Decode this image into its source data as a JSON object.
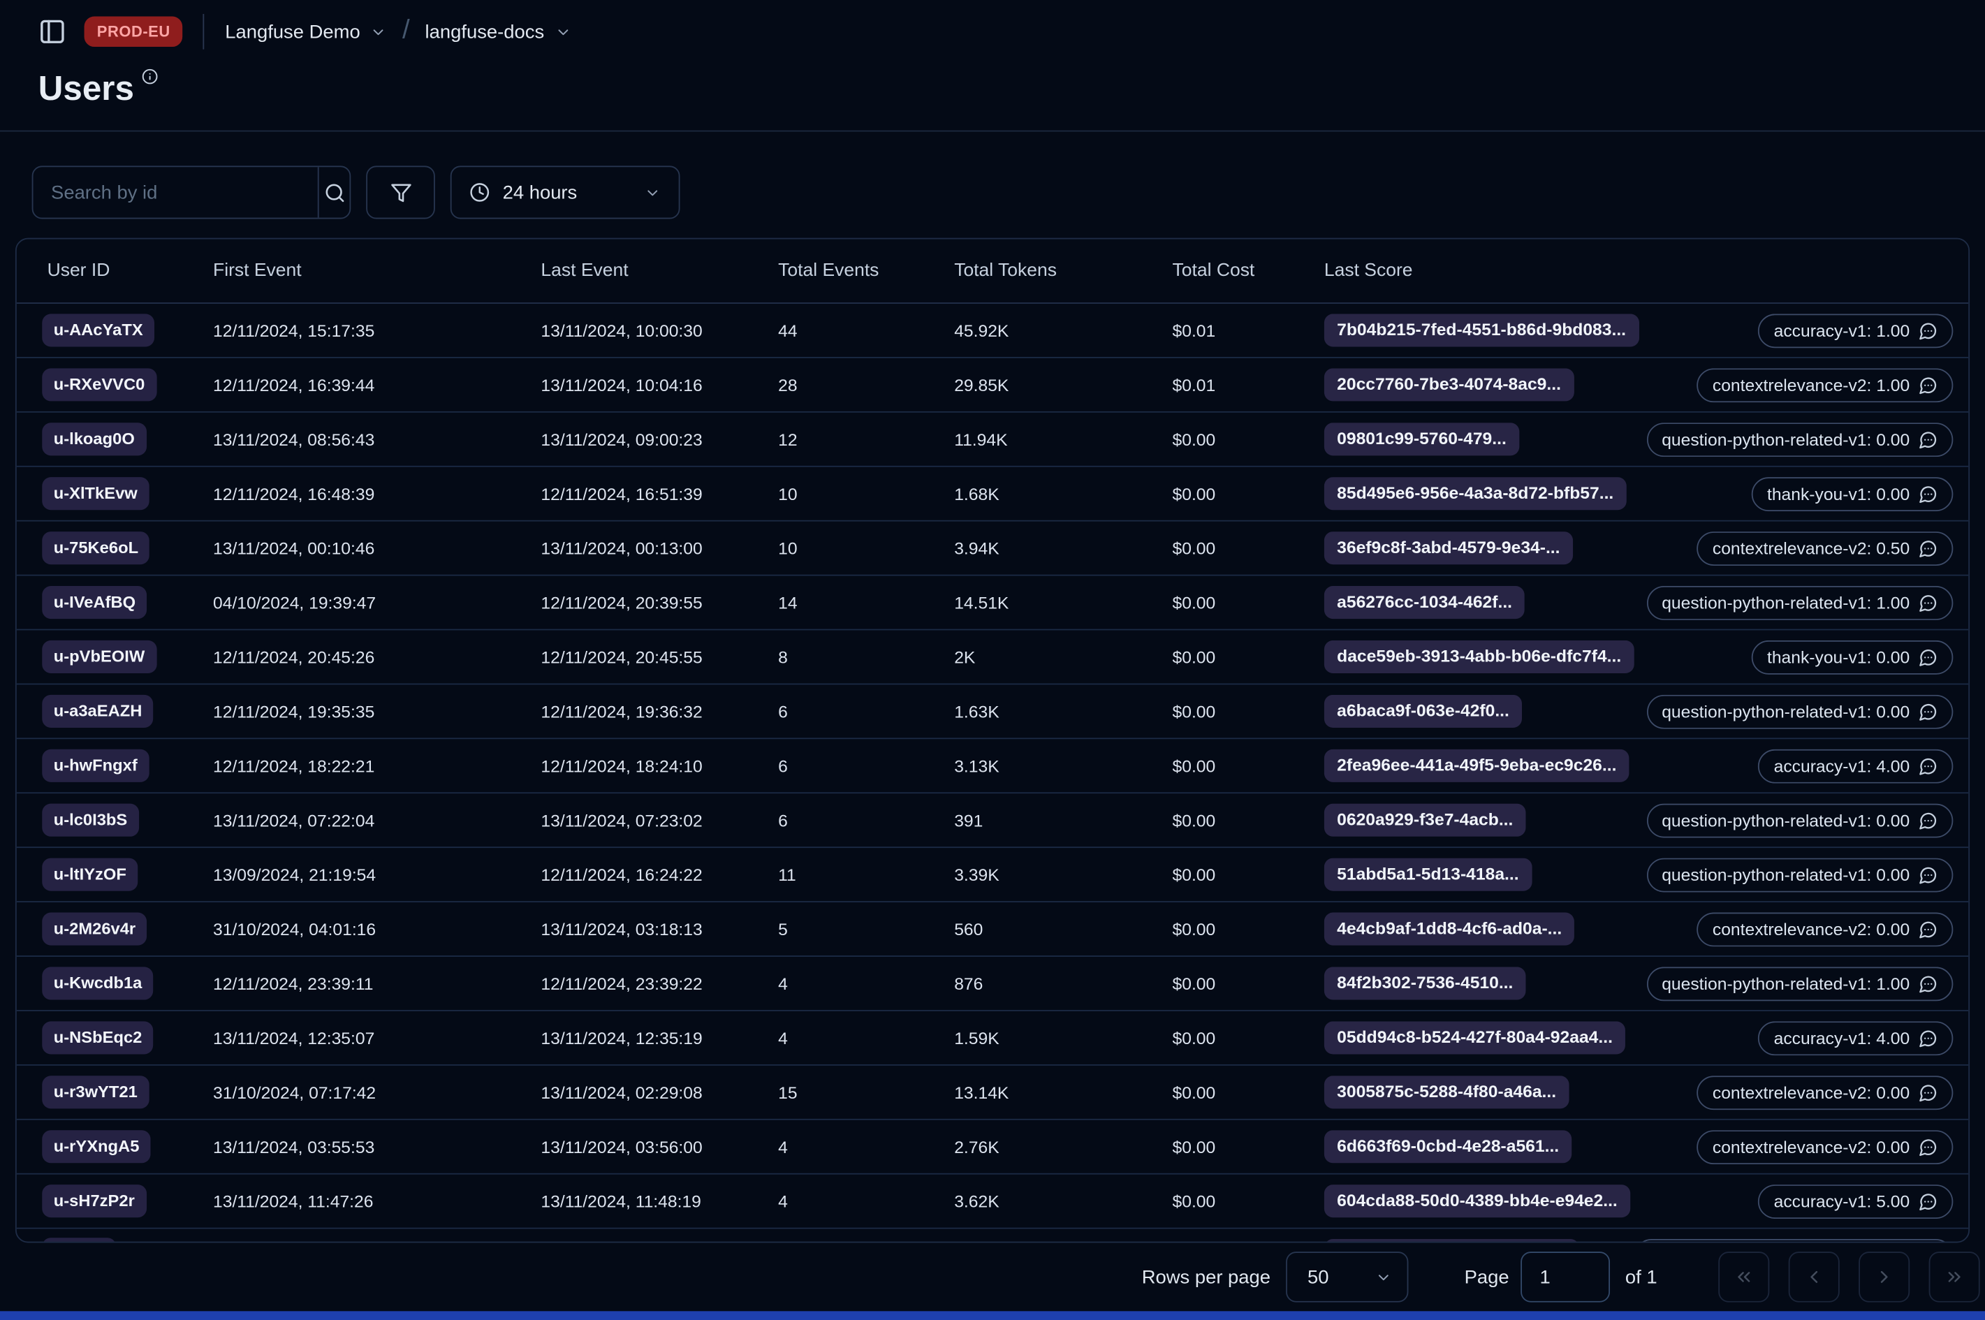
{
  "topbar": {
    "env_badge": "PROD-EU",
    "org_name": "Langfuse Demo",
    "breadcrumb_separator": "/",
    "project_name": "langfuse-docs"
  },
  "page": {
    "title": "Users"
  },
  "toolbar": {
    "search_placeholder": "Search by id",
    "time_range_value": "24 hours"
  },
  "table": {
    "columns": [
      "User ID",
      "First Event",
      "Last Event",
      "Total Events",
      "Total Tokens",
      "Total Cost",
      "Last Score"
    ],
    "rows": [
      {
        "user_id": "u-AAcYaTX",
        "first_event": "12/11/2024, 15:17:35",
        "last_event": "13/11/2024, 10:00:30",
        "total_events": "44",
        "total_tokens": "45.92K",
        "total_cost": "$0.01",
        "score_trace_id": "7b04b215-7fed-4551-b86d-9bd083...",
        "score_label": "accuracy-v1: 1.00"
      },
      {
        "user_id": "u-RXeVVC0",
        "first_event": "12/11/2024, 16:39:44",
        "last_event": "13/11/2024, 10:04:16",
        "total_events": "28",
        "total_tokens": "29.85K",
        "total_cost": "$0.01",
        "score_trace_id": "20cc7760-7be3-4074-8ac9...",
        "score_label": "contextrelevance-v2: 1.00"
      },
      {
        "user_id": "u-lkoag0O",
        "first_event": "13/11/2024, 08:56:43",
        "last_event": "13/11/2024, 09:00:23",
        "total_events": "12",
        "total_tokens": "11.94K",
        "total_cost": "$0.00",
        "score_trace_id": "09801c99-5760-479...",
        "score_label": "question-python-related-v1: 0.00"
      },
      {
        "user_id": "u-XlTkEvw",
        "first_event": "12/11/2024, 16:48:39",
        "last_event": "12/11/2024, 16:51:39",
        "total_events": "10",
        "total_tokens": "1.68K",
        "total_cost": "$0.00",
        "score_trace_id": "85d495e6-956e-4a3a-8d72-bfb57...",
        "score_label": "thank-you-v1: 0.00"
      },
      {
        "user_id": "u-75Ke6oL",
        "first_event": "13/11/2024, 00:10:46",
        "last_event": "13/11/2024, 00:13:00",
        "total_events": "10",
        "total_tokens": "3.94K",
        "total_cost": "$0.00",
        "score_trace_id": "36ef9c8f-3abd-4579-9e34-...",
        "score_label": "contextrelevance-v2: 0.50"
      },
      {
        "user_id": "u-IVeAfBQ",
        "first_event": "04/10/2024, 19:39:47",
        "last_event": "12/11/2024, 20:39:55",
        "total_events": "14",
        "total_tokens": "14.51K",
        "total_cost": "$0.00",
        "score_trace_id": "a56276cc-1034-462f...",
        "score_label": "question-python-related-v1: 1.00"
      },
      {
        "user_id": "u-pVbEOIW",
        "first_event": "12/11/2024, 20:45:26",
        "last_event": "12/11/2024, 20:45:55",
        "total_events": "8",
        "total_tokens": "2K",
        "total_cost": "$0.00",
        "score_trace_id": "dace59eb-3913-4abb-b06e-dfc7f4...",
        "score_label": "thank-you-v1: 0.00"
      },
      {
        "user_id": "u-a3aEAZH",
        "first_event": "12/11/2024, 19:35:35",
        "last_event": "12/11/2024, 19:36:32",
        "total_events": "6",
        "total_tokens": "1.63K",
        "total_cost": "$0.00",
        "score_trace_id": "a6baca9f-063e-42f0...",
        "score_label": "question-python-related-v1: 0.00"
      },
      {
        "user_id": "u-hwFngxf",
        "first_event": "12/11/2024, 18:22:21",
        "last_event": "12/11/2024, 18:24:10",
        "total_events": "6",
        "total_tokens": "3.13K",
        "total_cost": "$0.00",
        "score_trace_id": "2fea96ee-441a-49f5-9eba-ec9c26...",
        "score_label": "accuracy-v1: 4.00"
      },
      {
        "user_id": "u-lc0I3bS",
        "first_event": "13/11/2024, 07:22:04",
        "last_event": "13/11/2024, 07:23:02",
        "total_events": "6",
        "total_tokens": "391",
        "total_cost": "$0.00",
        "score_trace_id": "0620a929-f3e7-4acb...",
        "score_label": "question-python-related-v1: 0.00"
      },
      {
        "user_id": "u-ltIYzOF",
        "first_event": "13/09/2024, 21:19:54",
        "last_event": "12/11/2024, 16:24:22",
        "total_events": "11",
        "total_tokens": "3.39K",
        "total_cost": "$0.00",
        "score_trace_id": "51abd5a1-5d13-418a...",
        "score_label": "question-python-related-v1: 0.00"
      },
      {
        "user_id": "u-2M26v4r",
        "first_event": "31/10/2024, 04:01:16",
        "last_event": "13/11/2024, 03:18:13",
        "total_events": "5",
        "total_tokens": "560",
        "total_cost": "$0.00",
        "score_trace_id": "4e4cb9af-1dd8-4cf6-ad0a-...",
        "score_label": "contextrelevance-v2: 0.00"
      },
      {
        "user_id": "u-Kwcdb1a",
        "first_event": "12/11/2024, 23:39:11",
        "last_event": "12/11/2024, 23:39:22",
        "total_events": "4",
        "total_tokens": "876",
        "total_cost": "$0.00",
        "score_trace_id": "84f2b302-7536-4510...",
        "score_label": "question-python-related-v1: 1.00"
      },
      {
        "user_id": "u-NSbEqc2",
        "first_event": "13/11/2024, 12:35:07",
        "last_event": "13/11/2024, 12:35:19",
        "total_events": "4",
        "total_tokens": "1.59K",
        "total_cost": "$0.00",
        "score_trace_id": "05dd94c8-b524-427f-80a4-92aa4...",
        "score_label": "accuracy-v1: 4.00"
      },
      {
        "user_id": "u-r3wYT21",
        "first_event": "31/10/2024, 07:17:42",
        "last_event": "13/11/2024, 02:29:08",
        "total_events": "15",
        "total_tokens": "13.14K",
        "total_cost": "$0.00",
        "score_trace_id": "3005875c-5288-4f80-a46a...",
        "score_label": "contextrelevance-v2: 0.00"
      },
      {
        "user_id": "u-rYXngA5",
        "first_event": "13/11/2024, 03:55:53",
        "last_event": "13/11/2024, 03:56:00",
        "total_events": "4",
        "total_tokens": "2.76K",
        "total_cost": "$0.00",
        "score_trace_id": "6d663f69-0cbd-4e28-a561...",
        "score_label": "contextrelevance-v2: 0.00"
      },
      {
        "user_id": "u-sH7zP2r",
        "first_event": "13/11/2024, 11:47:26",
        "last_event": "13/11/2024, 11:48:19",
        "total_events": "4",
        "total_tokens": "3.62K",
        "total_cost": "$0.00",
        "score_trace_id": "604cda88-50d0-4389-bb4e-e94e2...",
        "score_label": "accuracy-v1: 5.00"
      },
      {
        "user_id": "",
        "first_event": "",
        "last_event": "",
        "total_events": "",
        "total_tokens": "",
        "total_cost": "",
        "score_trace_id": "",
        "score_label": "",
        "partial": true
      }
    ]
  },
  "pagination": {
    "rows_per_page_label": "Rows per page",
    "rows_per_page_value": "50",
    "page_label": "Page",
    "page_value": "1",
    "of_label": "of 1"
  },
  "icons": {
    "sidebar_toggle": "panel-left",
    "title_info": "info-circle",
    "search": "magnifier",
    "filter": "funnel",
    "time_range": "clock",
    "score_comment": "speech-bubble-dots",
    "pagination": [
      "chevrons-left",
      "chevron-left",
      "chevron-right",
      "chevrons-right"
    ]
  },
  "colors": {
    "background": "#040a16",
    "env_badge_bg": "#8f1d1d",
    "env_badge_text": "#fca5a5",
    "badge_bg": "#282545",
    "control_border": "#27354f",
    "bottom_bar": "#1e40af"
  }
}
